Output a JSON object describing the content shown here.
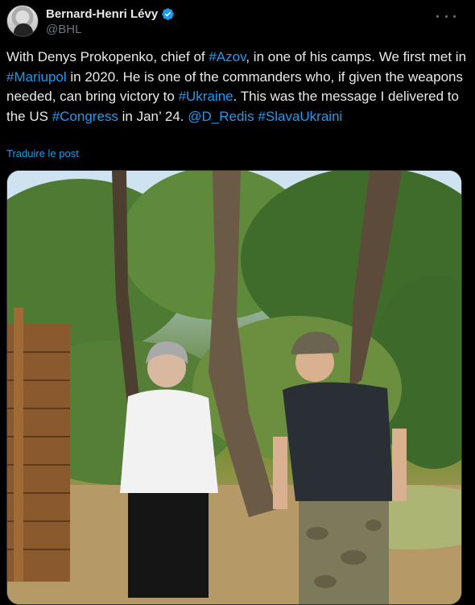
{
  "author": {
    "display_name": "Bernard-Henri Lévy",
    "handle": "@BHL",
    "verified_color": "#1d9bf0"
  },
  "tweet": {
    "segments": [
      {
        "text": "With Denys Prokopenko, chief of ",
        "link": false
      },
      {
        "text": "#Azov",
        "link": true
      },
      {
        "text": ", in one of his camps. We first met in ",
        "link": false
      },
      {
        "text": "#Mariupol",
        "link": true
      },
      {
        "text": " in 2020. He is one of the commanders who, if given the weapons needed, can bring victory to ",
        "link": false
      },
      {
        "text": "#Ukraine",
        "link": true
      },
      {
        "text": ". This was the message I delivered to the US ",
        "link": false
      },
      {
        "text": "#Congress",
        "link": true
      },
      {
        "text": " in Jan’ 24. ",
        "link": false
      },
      {
        "text": "@D_Redis",
        "link": true
      },
      {
        "text": " ",
        "link": false
      },
      {
        "text": "#SlavaUkraini",
        "link": true
      }
    ],
    "translate_label": "Traduire le post"
  },
  "icons": {
    "verified": "verified-badge-icon",
    "more": "more-options-icon"
  },
  "colors": {
    "background": "#000000",
    "text": "#e7e9ea",
    "muted": "#71767b",
    "link": "#1d9bf0"
  }
}
